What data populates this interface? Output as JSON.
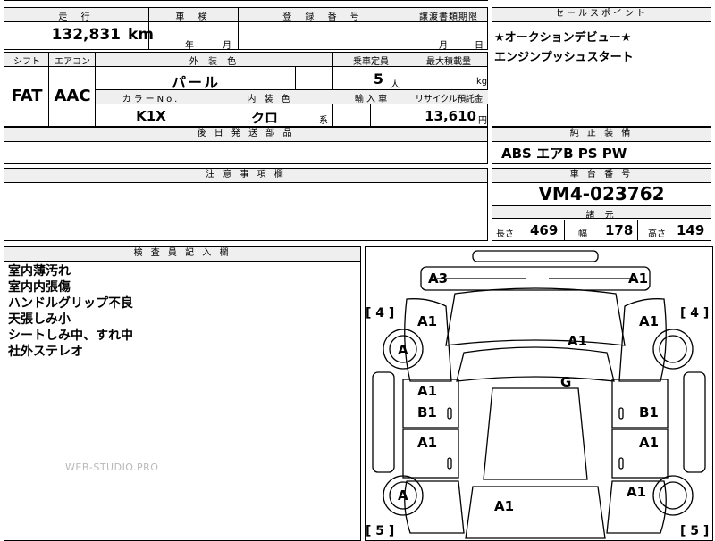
{
  "header": {
    "mileage_label": "走 行",
    "inspection_label": "車 検",
    "registration_label": "登 録 番 号",
    "transfer_label": "譲渡書類期限",
    "sales_point_label": "セールスポイント"
  },
  "values": {
    "mileage": "132,831",
    "mileage_unit": "km",
    "inspection_year": "年",
    "inspection_month": "月",
    "transfer_month": "月",
    "transfer_day": "日"
  },
  "sales_points": [
    "★オークションデビュー★",
    "エンジンプッシュスタート"
  ],
  "row2": {
    "shift_label": "シフト",
    "aircon_label": "エアコン",
    "exterior_label": "外 装 色",
    "capacity_label": "乗車定員",
    "max_load_label": "最大積載量",
    "shift": "FAT",
    "aircon": "AAC",
    "exterior": "パール",
    "capacity": "5",
    "capacity_unit": "人",
    "load_unit": "kg",
    "color_no_label": "カラーNo.",
    "interior_label": "内 装 色",
    "import_label": "輸 入 車",
    "recycle_label": "リサイクル預託金",
    "color_no": "K1X",
    "interior": "クロ",
    "interior_suffix": "系",
    "recycle": "13,610",
    "recycle_unit": "円"
  },
  "shipping": {
    "label": "後 日 発 送 部 品"
  },
  "equipment": {
    "label": "純 正 装 備",
    "value": "ABS エアB PS PW"
  },
  "caution": {
    "label": "注 意 事 項 欄"
  },
  "chassis": {
    "label": "車 台 番 号",
    "value": "VM4-023762",
    "spec_label": "諸 元",
    "length_label": "長さ",
    "length": "469",
    "width_label": "幅",
    "width": "178",
    "height_label": "高さ",
    "height": "149"
  },
  "inspector": {
    "label": "検 査 員 記 入 欄",
    "notes": [
      "室内薄汚れ",
      "室内内張傷",
      "ハンドルグリップ不良",
      "天張しみ小",
      "シートしみ中、すれ中",
      "社外ステレオ"
    ]
  },
  "diagram": {
    "marks": {
      "rear_left": "A3",
      "rear_right": "A1",
      "left_rear_quarter": "A1",
      "right_rear_quarter": "A1",
      "roof": "A1",
      "rear_left_tire": "A",
      "glass": "G",
      "left_rear_door_1": "A1",
      "left_rear_door_2": "B1",
      "right_rear_door": "B1",
      "left_front_door": "A1",
      "right_front_door": "A1",
      "front_left_tire": "A",
      "right_front_fender": "A1",
      "hood": "A1"
    },
    "tire_rear_left": "[ 4 ]",
    "tire_rear_right": "[ 4 ]",
    "tire_front_left": "[ 5 ]",
    "tire_front_right": "[ 5 ]"
  },
  "watermark": "WEB-STUDIO.PRO"
}
